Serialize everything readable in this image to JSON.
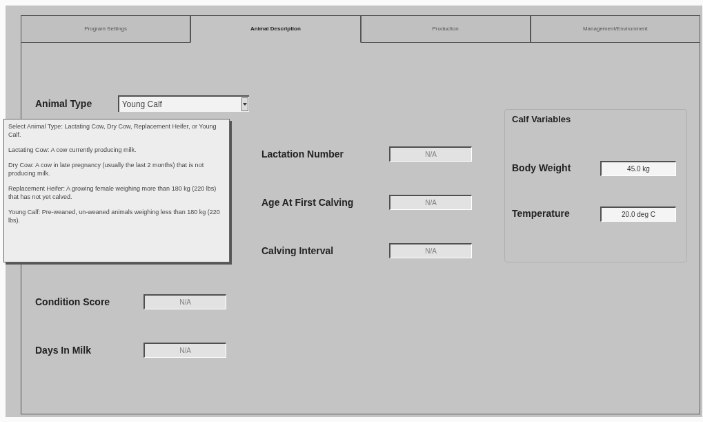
{
  "tabs": [
    {
      "label": "Program Settings",
      "selected": false
    },
    {
      "label": "Animal Description",
      "selected": true
    },
    {
      "label": "Production",
      "selected": false
    },
    {
      "label": "Management/Environment",
      "selected": false
    }
  ],
  "animal_type": {
    "label": "Animal Type",
    "value": "Young Calf"
  },
  "tooltip": [
    "Select Animal Type:  Lactating Cow, Dry Cow, Replacement Heifer, or Young Calf.",
    "Lactating Cow:  A cow currently producing milk.",
    "Dry Cow:  A cow in late pregnancy (usually the last 2 months) that is not producing milk.",
    "Replacement Heifer:  A growing female weighing more than 180 kg (220 lbs) that has not yet calved.",
    "Young Calf:  Pre-weaned, un-weaned animals weighing less than 180 kg (220 lbs)."
  ],
  "left_fields": [
    {
      "label": "Condition Score",
      "value": "N/A",
      "disabled": true
    },
    {
      "label": "Days In Milk",
      "value": "N/A",
      "disabled": true
    }
  ],
  "middle_fields": [
    {
      "label": "Lactation Number",
      "value": "N/A",
      "disabled": true
    },
    {
      "label": "Age At First Calving",
      "value": "N/A",
      "disabled": true
    },
    {
      "label": "Calving Interval",
      "value": "N/A",
      "disabled": true
    }
  ],
  "calf_variables": {
    "title": "Calf Variables",
    "fields": [
      {
        "label": "Body Weight",
        "value": "45.0 kg",
        "disabled": false
      },
      {
        "label": "Temperature",
        "value": "20.0 deg C",
        "disabled": false
      }
    ]
  }
}
